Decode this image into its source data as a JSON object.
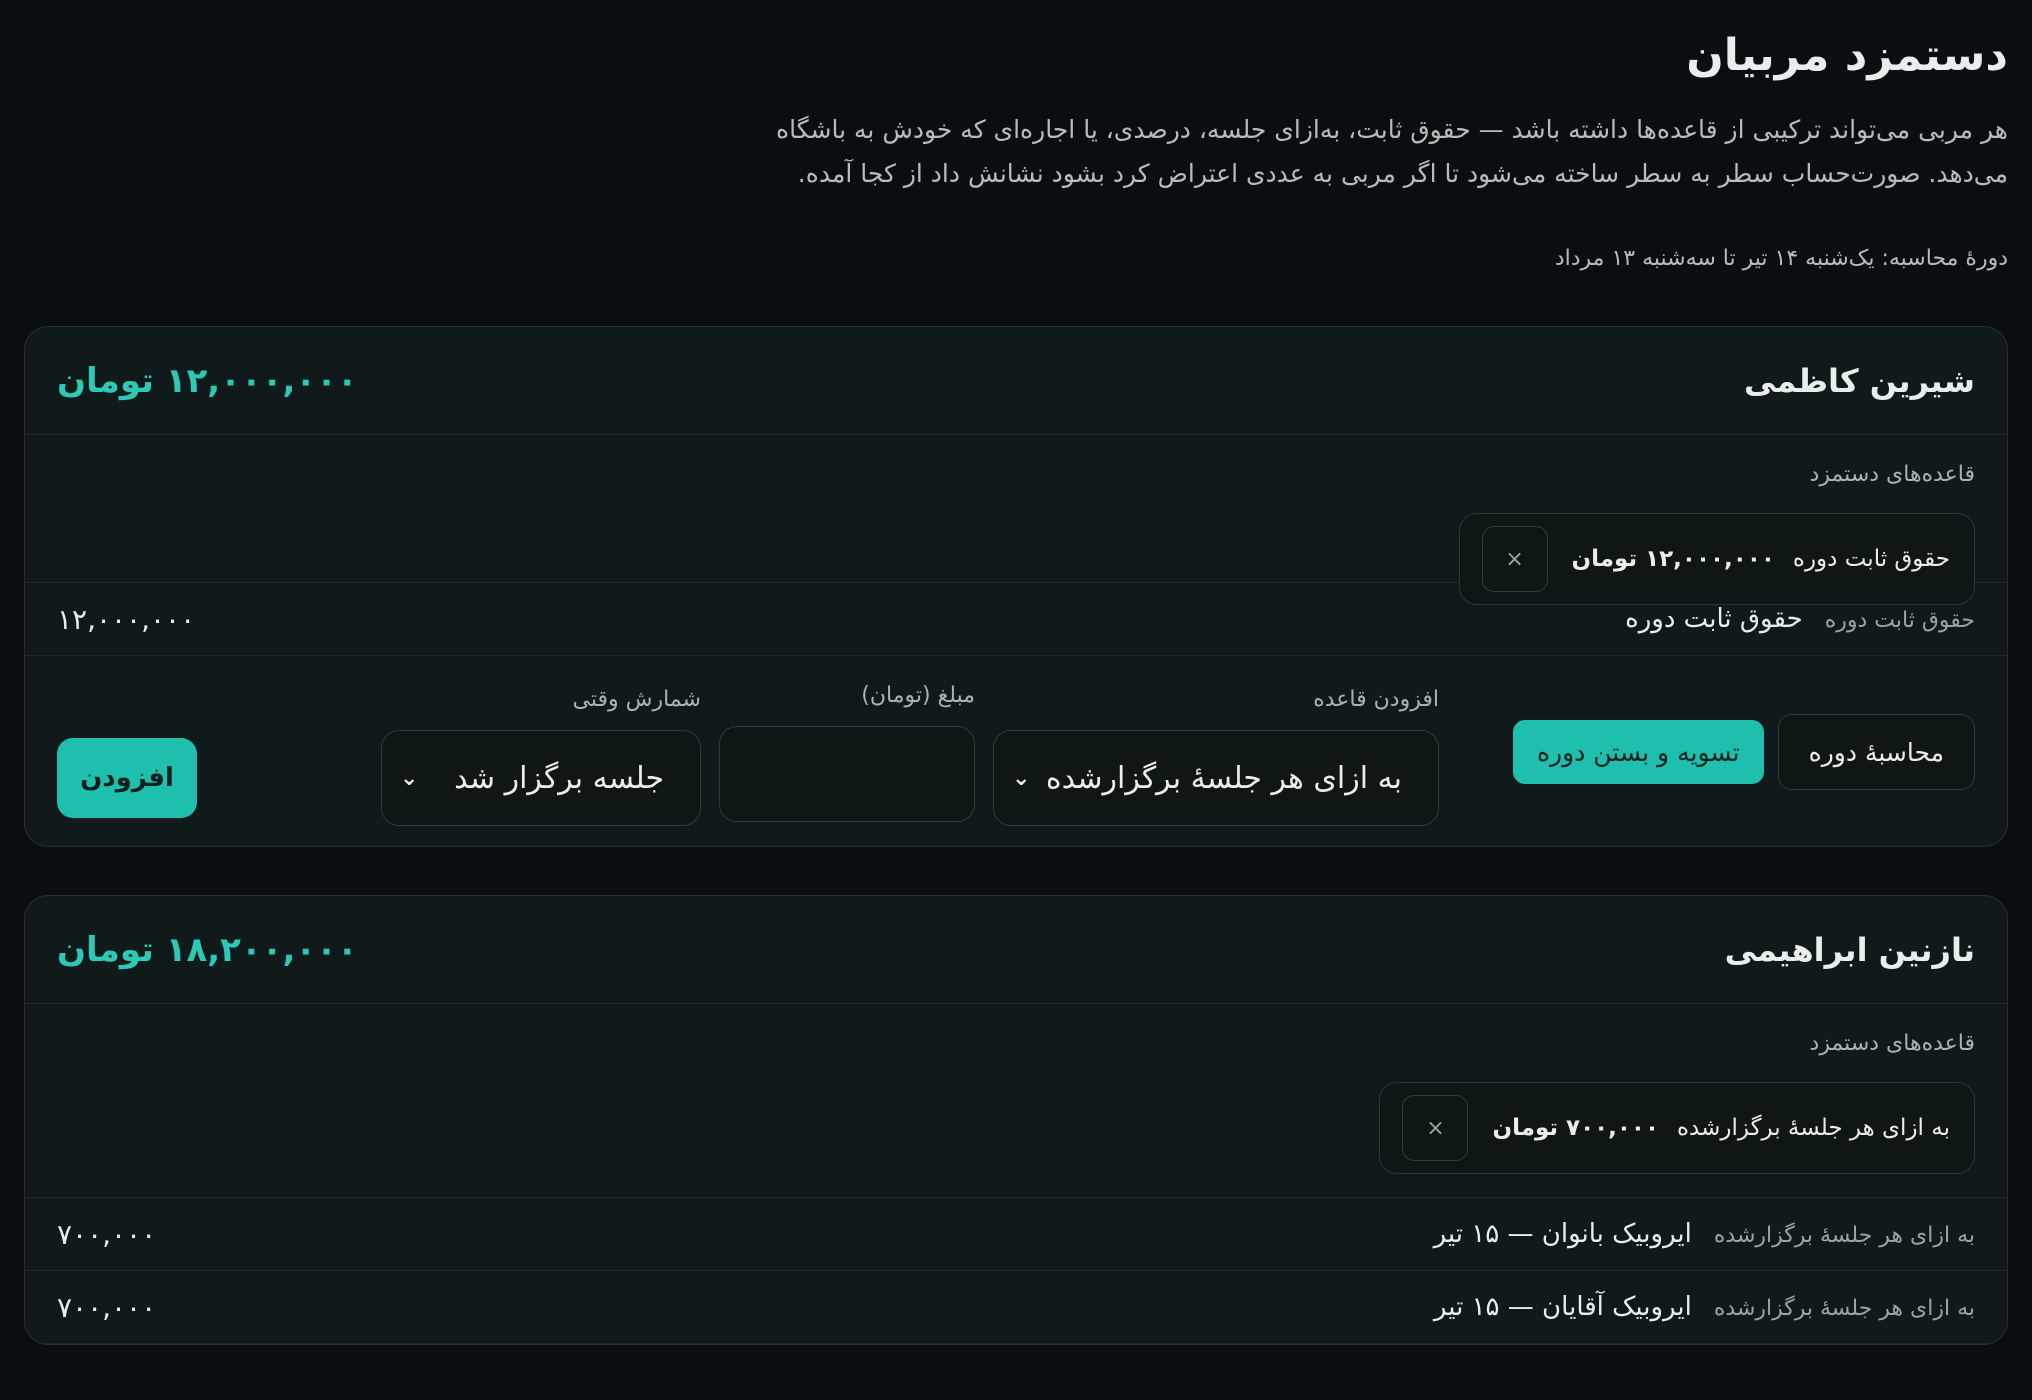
{
  "page": {
    "title": "دستمزد مربیان",
    "description_line1": "هر مربی می‌تواند ترکیبی از قاعده‌ها داشته باشد — حقوق ثابت، به‌ازای جلسه، درصدی، یا اجاره‌ای که خودش به باشگاه",
    "description_line2": "می‌دهد. صورت‌حساب سطر به سطر ساخته می‌شود تا اگر مربی به عددی اعتراض کرد بشود نشانش داد از کجا آمده.",
    "period": "دورهٔ محاسبه: یک‌شنبه ۱۴ تیر تا سه‌شنبه ۱۳ مرداد"
  },
  "coaches": [
    {
      "name": "شیرین کاظمی",
      "total": "۱۲,۰۰۰,۰۰۰ تومان",
      "rules_label": "قاعده‌های دستمزد",
      "rules": [
        {
          "type": "حقوق ثابت دوره",
          "amount": "۱۲,۰۰۰,۰۰۰ تومان",
          "remove": "×"
        }
      ],
      "lines": [
        {
          "type": "حقوق ثابت دوره",
          "desc": "حقوق ثابت دوره",
          "amount": "۱۲,۰۰۰,۰۰۰"
        }
      ],
      "actions": {
        "calculate": "محاسبهٔ دوره",
        "settle": "تسویه و بستن دوره",
        "add_rule_label": "افزودن قاعده",
        "add_rule_value": "به ازای هر جلسهٔ برگزارشده",
        "amount_label": "مبلغ (تومان)",
        "amount_value": "",
        "counting_label": "شمارش وقتی",
        "counting_value": "جلسه برگزار شد",
        "add_button": "افزودن"
      }
    },
    {
      "name": "نازنین ابراهیمی",
      "total": "۱۸,۲۰۰,۰۰۰ تومان",
      "rules_label": "قاعده‌های دستمزد",
      "rules": [
        {
          "type": "به ازای هر جلسهٔ برگزارشده",
          "amount": "۷۰۰,۰۰۰ تومان",
          "remove": "×"
        }
      ],
      "lines": [
        {
          "type": "به ازای هر جلسهٔ برگزارشده",
          "desc": "ایروبیک بانوان — ۱۵ تیر",
          "amount": "۷۰۰,۰۰۰"
        },
        {
          "type": "به ازای هر جلسهٔ برگزارشده",
          "desc": "ایروبیک آقایان — ۱۵ تیر",
          "amount": "۷۰۰,۰۰۰"
        }
      ]
    }
  ],
  "colors": {
    "accent": "#1fbfae",
    "background": "#0a0e10",
    "card": "#111a1a"
  }
}
